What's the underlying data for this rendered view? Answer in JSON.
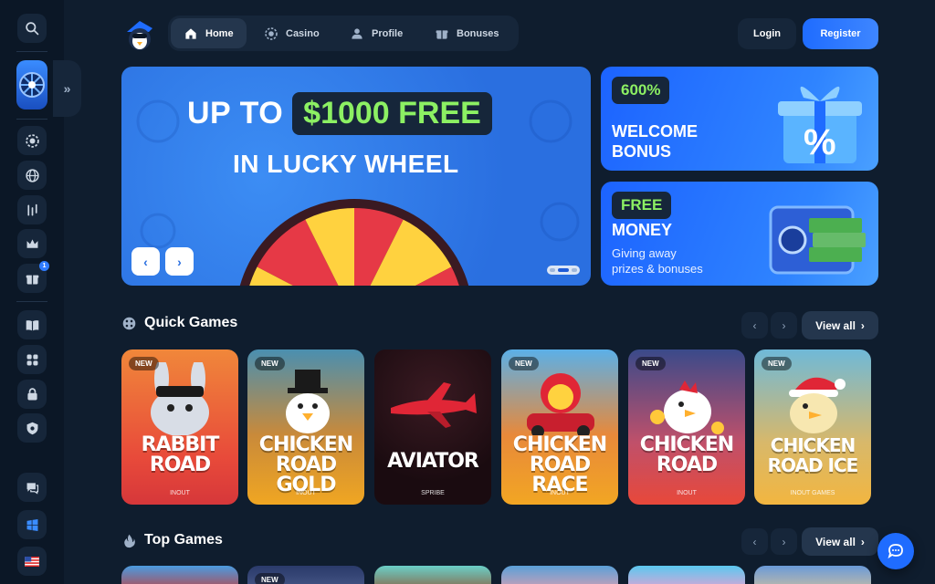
{
  "nav": {
    "items": [
      {
        "label": "Home",
        "icon": "home-icon",
        "active": true
      },
      {
        "label": "Casino",
        "icon": "casino-chip-icon",
        "active": false
      },
      {
        "label": "Profile",
        "icon": "user-icon",
        "active": false
      },
      {
        "label": "Bonuses",
        "icon": "gift-icon",
        "active": false
      }
    ],
    "login_label": "Login",
    "register_label": "Register"
  },
  "sidebar": {
    "icons": [
      "search-icon",
      "lucky-wheel-icon",
      "casino-chip-icon",
      "globe-icon",
      "sports-icon",
      "crown-icon",
      "gift-icon",
      "book-icon",
      "gamepad-icon",
      "lock-icon",
      "shield-icon",
      "support-chat-icon",
      "windows-icon",
      "us-flag-icon"
    ],
    "gift_badge": "1"
  },
  "hero": {
    "line1_prefix": "UP TO",
    "line1_highlight": "$1000 FREE",
    "line2": "IN LUCKY WHEEL"
  },
  "promos": [
    {
      "pill": "600%",
      "title_1": "WELCOME",
      "title_2": "BONUS"
    },
    {
      "pill": "FREE",
      "title_1": "MONEY",
      "desc_1": "Giving away",
      "desc_2": "prizes & bonuses"
    }
  ],
  "quick_games": {
    "title": "Quick Games",
    "view_all": "View all",
    "games": [
      {
        "t1": "RABBIT",
        "t2": "ROAD",
        "provider": "INOUT",
        "new": "NEW"
      },
      {
        "t1": "CHICKEN",
        "t2": "ROAD GOLD",
        "provider": "INOUT",
        "new": "NEW"
      },
      {
        "t1": "AVIATOR",
        "t2": "",
        "provider": "SPRIBE",
        "new": ""
      },
      {
        "t1": "CHICKEN",
        "t2": "ROAD RACE",
        "provider": "INOUT",
        "new": "NEW"
      },
      {
        "t1": "CHICKEN",
        "t2": "ROAD",
        "provider": "INOUT",
        "new": "NEW"
      },
      {
        "t1": "CHICKEN",
        "t2": "ROAD ICE",
        "provider": "INOUT GAMES",
        "new": "NEW"
      }
    ]
  },
  "top_games": {
    "title": "Top Games",
    "view_all": "View all",
    "second_card_badge": "NEW"
  },
  "colors": {
    "accent": "#1f6cff",
    "highlight_green": "#8cf063",
    "bg": "#0f1d2e"
  }
}
